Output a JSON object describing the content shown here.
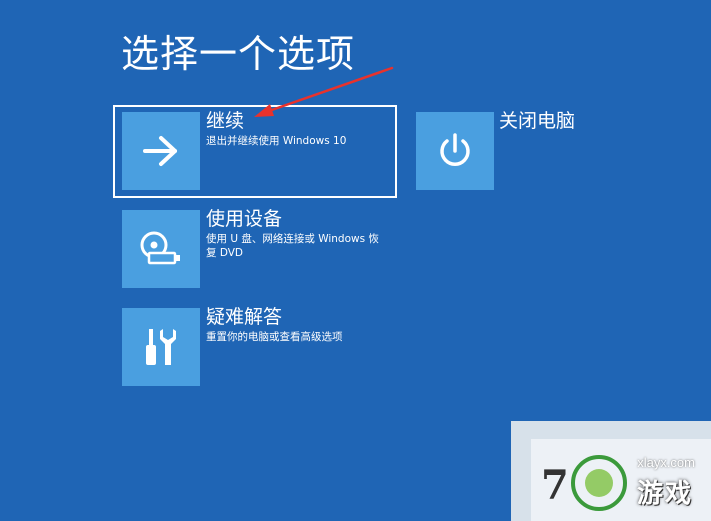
{
  "page_title": "选择一个选项",
  "options": [
    {
      "title": "继续",
      "description": "退出并继续使用 Windows 10",
      "icon": "arrow-right-icon",
      "selected": true
    },
    {
      "title": "关闭电脑",
      "description": "",
      "icon": "power-icon",
      "selected": false
    },
    {
      "title": "使用设备",
      "description": "使用 U 盘、网络连接或 Windows 恢复 DVD",
      "icon": "usb-disc-icon",
      "selected": false
    },
    {
      "title": "疑难解答",
      "description": "重置你的电脑或查看高级选项",
      "icon": "tools-icon",
      "selected": false
    }
  ],
  "annotation": {
    "color": "#e8322c"
  },
  "watermark": {
    "url": "xlayx.com",
    "brand": "游戏"
  },
  "colors": {
    "background": "#1f65b5",
    "tile": "#4a9fe0",
    "text": "#ffffff"
  }
}
